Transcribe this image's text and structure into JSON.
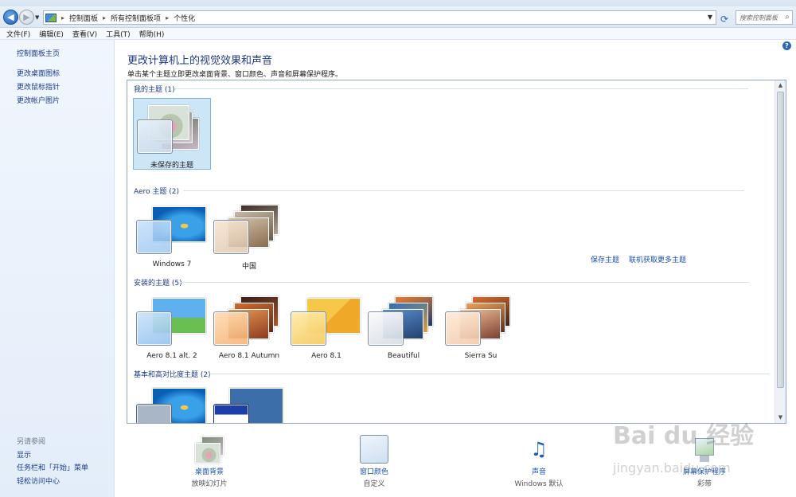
{
  "address": {
    "crumbs": [
      "控制面板",
      "所有控制面板项",
      "个性化"
    ],
    "search_placeholder": "搜索控制面板"
  },
  "menu": [
    "文件(F)",
    "编辑(E)",
    "查看(V)",
    "工具(T)",
    "帮助(H)"
  ],
  "left": {
    "home": "控制面板主页",
    "links": [
      "更改桌面图标",
      "更改鼠标指针",
      "更改帐户图片"
    ],
    "see_also_heading": "另请参阅",
    "see_also": [
      "显示",
      "任务栏和「开始」菜单",
      "轻松访问中心"
    ]
  },
  "main": {
    "title": "更改计算机上的视觉效果和声音",
    "subtitle": "单击某个主题立即更改桌面背景、窗口颜色、声音和屏幕保护程序。",
    "groups": {
      "my": "我的主题 (1)",
      "aero": "Aero 主题 (2)",
      "installed": "安装的主题 (5)",
      "basic": "基本和高对比度主题 (2)"
    },
    "my_themes": [
      "未保存的主题"
    ],
    "aero_themes": [
      "Windows 7",
      "中国"
    ],
    "installed_themes": [
      "Aero 8.1 alt. 2",
      "Aero 8.1 Autumn",
      "Aero 8.1",
      "Beautiful",
      "Sierra Su"
    ],
    "save_theme": "保存主题",
    "get_more": "联机获取更多主题"
  },
  "bottom": [
    {
      "label": "桌面背景",
      "value": "放映幻灯片"
    },
    {
      "label": "窗口颜色",
      "value": "自定义"
    },
    {
      "label": "声音",
      "value": "Windows 默认"
    },
    {
      "label": "屏幕保护程序",
      "value": "彩带"
    }
  ],
  "watermark": {
    "line1": "Bai du 经验",
    "line2": "jingyan.baidu.com"
  }
}
